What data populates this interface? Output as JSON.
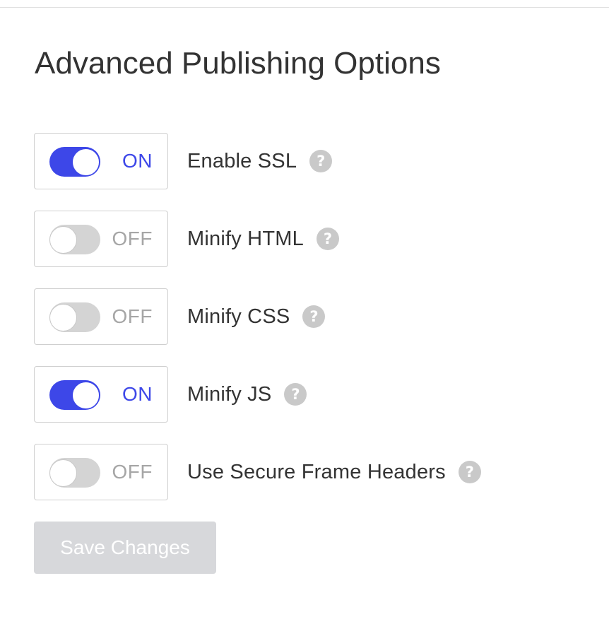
{
  "page": {
    "title": "Advanced Publishing Options"
  },
  "options": [
    {
      "label": "Enable SSL",
      "enabled": true,
      "state_text": "ON",
      "help_icon": "question-mark-icon"
    },
    {
      "label": "Minify HTML",
      "enabled": false,
      "state_text": "OFF",
      "help_icon": "question-mark-icon"
    },
    {
      "label": "Minify CSS",
      "enabled": false,
      "state_text": "OFF",
      "help_icon": "question-mark-icon"
    },
    {
      "label": "Minify JS",
      "enabled": true,
      "state_text": "ON",
      "help_icon": "question-mark-icon"
    },
    {
      "label": "Use Secure Frame Headers",
      "enabled": false,
      "state_text": "OFF",
      "help_icon": "question-mark-icon"
    }
  ],
  "help_glyph": "?",
  "save_button": {
    "label": "Save Changes",
    "disabled": true
  },
  "colors": {
    "accent": "#3d47e8",
    "toggle_off": "#d4d4d4",
    "help_icon": "#c9c9c9",
    "disabled_button": "#d7d8db"
  }
}
